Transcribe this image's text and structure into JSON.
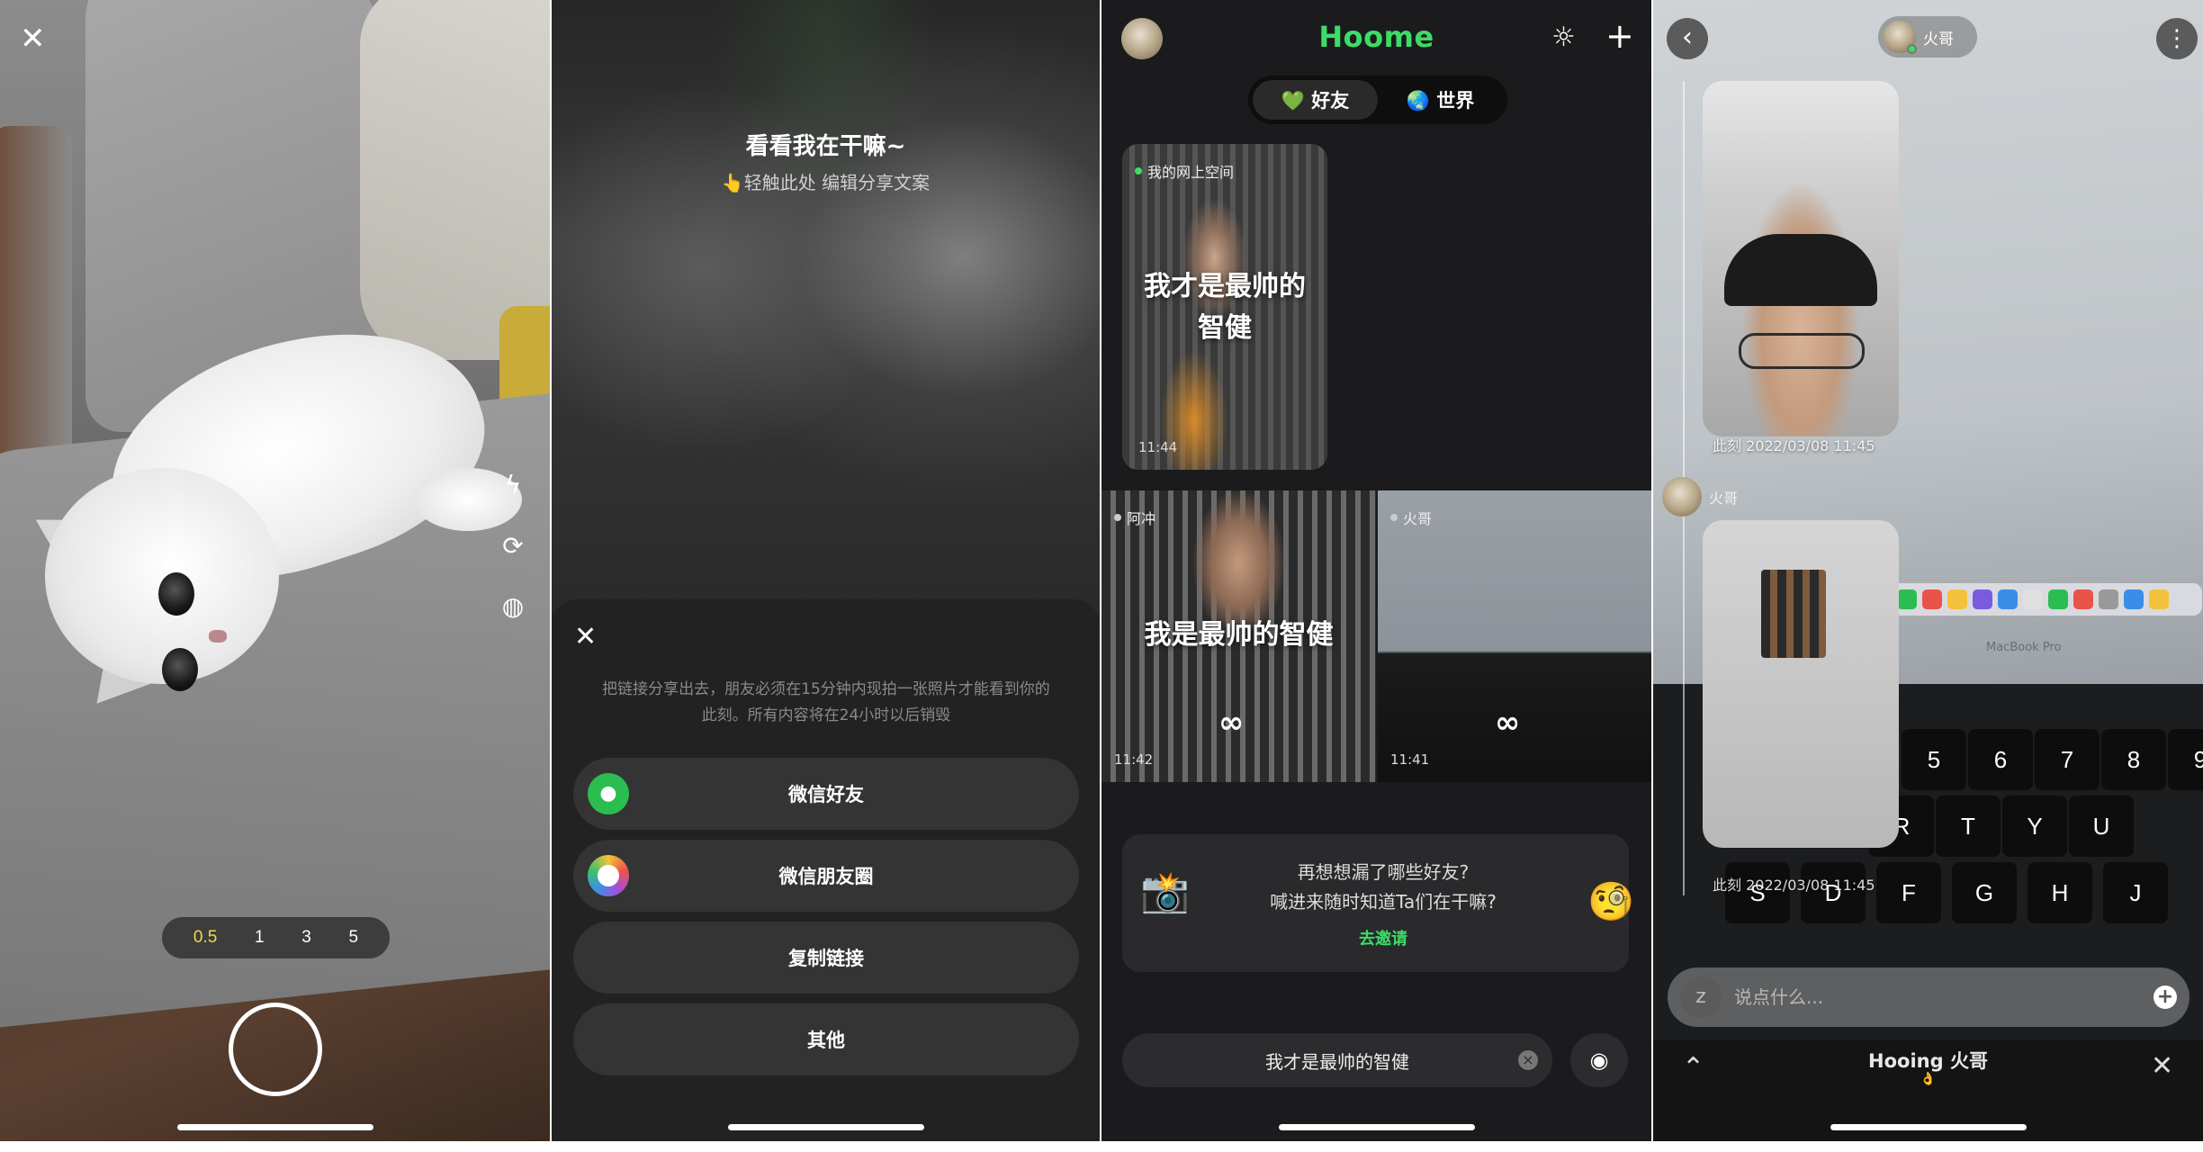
{
  "camera": {
    "close_icon": "close-icon",
    "zoom_levels": [
      "0.5",
      "1",
      "3",
      "5"
    ],
    "active_zoom": "0.5",
    "active_zoom_color": "#f2d74a"
  },
  "share": {
    "title": "看看我在干嘛~",
    "subtitle": "👆轻触此处 编辑分享文案",
    "note": "把链接分享出去，朋友必须在15分钟内现拍一张照片才能看到你的此刻。所有内容将在24小时以后销毁",
    "options": [
      "微信好友",
      "微信朋友圈",
      "复制链接",
      "其他"
    ]
  },
  "feed": {
    "brand": "Hoome",
    "brand_color": "#3ddc67",
    "tabs": [
      "💚 好友",
      "🌏 世界"
    ],
    "cards": [
      {
        "label": "我的网上空间",
        "caption": "我才是最帅的智健",
        "time": "11:44"
      },
      {
        "label": "阿冲",
        "caption": "我是最帅的智健",
        "time": "11:42"
      },
      {
        "label": "火哥",
        "caption": "",
        "time": "11:41"
      }
    ],
    "invite": {
      "line1": "再想想漏了哪些好友?",
      "line2": "喊进来随时知道Ta们在干嘛?",
      "link": "去邀请"
    },
    "compose_text": "我才是最帅的智健"
  },
  "chat": {
    "user_name": "火哥",
    "side_name": "火哥",
    "timestamp1": "此刻 2022/03/08 11:45",
    "timestamp2": "此刻 2022/03/08 11:45",
    "laptop_label": "MacBook Pro",
    "input_placeholder": "说点什么...",
    "bottom_label": "Hooing 火哥",
    "bottom_sub": "👌",
    "keys": [
      "5",
      "6",
      "7",
      "8",
      "9",
      "R",
      "T",
      "Y",
      "U",
      "S",
      "D",
      "F",
      "G",
      "H",
      "J"
    ]
  }
}
